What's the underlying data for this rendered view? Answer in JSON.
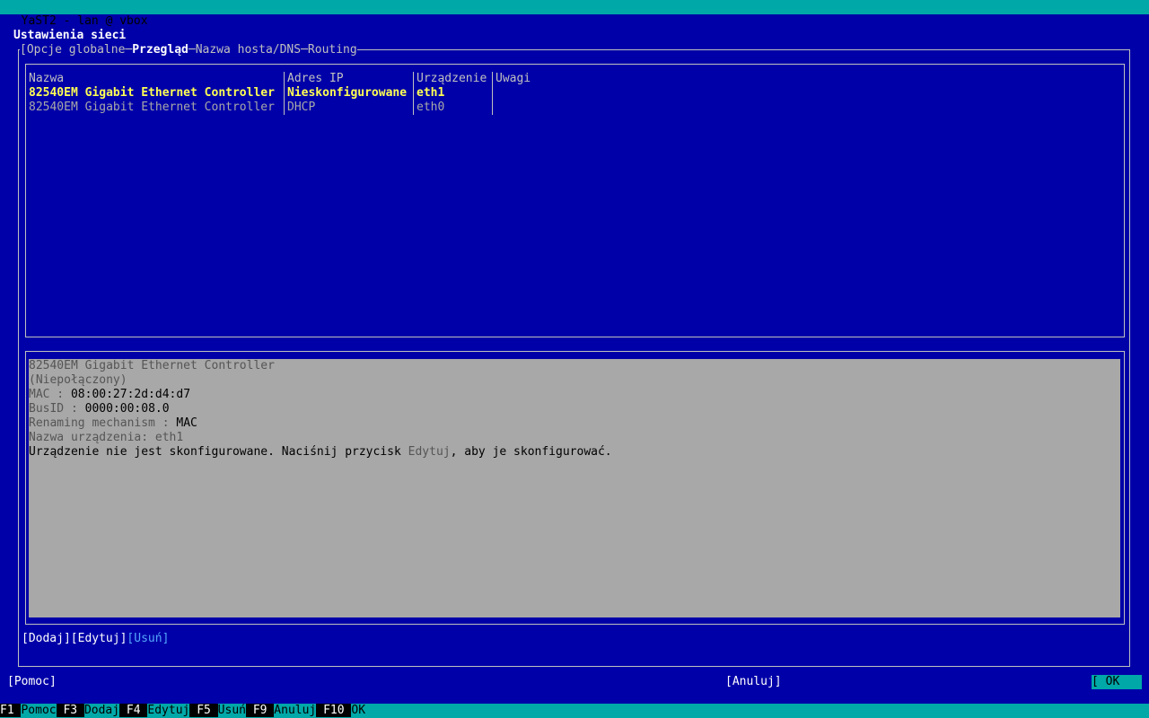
{
  "window": {
    "title": "YaST2 - lan @ vbox"
  },
  "dialog": {
    "title": "Ustawienia sieci"
  },
  "tabs": [
    {
      "label": "Opcje globalne"
    },
    {
      "label": "Przegląd"
    },
    {
      "label": "Nazwa hosta/DNS"
    },
    {
      "label": "Routing"
    }
  ],
  "table": {
    "headers": [
      "Nazwa",
      "Adres IP",
      "Urządzenie",
      "Uwagi"
    ],
    "rows": [
      {
        "name": "82540EM Gigabit Ethernet Controller",
        "ip": "Nieskonfigurowane",
        "device": "eth1",
        "notes": ""
      },
      {
        "name": "82540EM Gigabit Ethernet Controller",
        "ip": "DHCP",
        "device": "eth0",
        "notes": ""
      }
    ]
  },
  "details": {
    "title": "82540EM Gigabit Ethernet Controller",
    "status": "(Niepołączony)",
    "mac_label": "MAC : ",
    "mac": "08:00:27:2d:d4:d7",
    "busid_label": "BusID : ",
    "busid": "0000:00:08.0",
    "renaming_label": "Renaming mechanism : ",
    "renaming": "MAC",
    "devname_label": "Nazwa urządzenia: eth1",
    "message_pre": "Urządzenie nie jest skonfigurowane. Naciśnij przycisk ",
    "message_link": "Edytuj",
    "message_post": ", aby je skonfigurować."
  },
  "buttons": {
    "add": "Dodaj",
    "edit": "Edytuj",
    "delete": "Usuń",
    "help": "Pomoc",
    "cancel": "Anuluj",
    "ok": "OK"
  },
  "fkeys": [
    {
      "key": "F1",
      "label": "Pomoc"
    },
    {
      "key": "F3",
      "label": "Dodaj"
    },
    {
      "key": "F4",
      "label": "Edytuj"
    },
    {
      "key": "F5",
      "label": "Usuń"
    },
    {
      "key": "F9",
      "label": "Anuluj"
    },
    {
      "key": "F10",
      "label": "OK"
    }
  ]
}
